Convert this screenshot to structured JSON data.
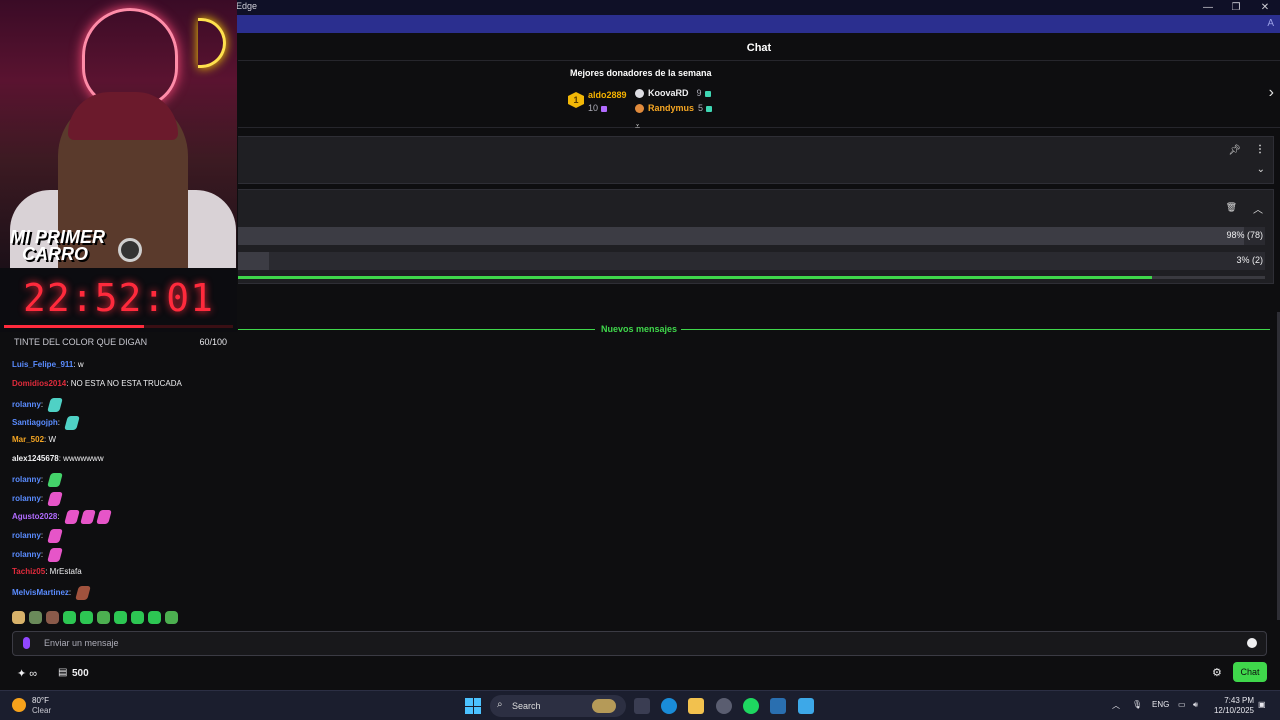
{
  "window": {
    "title": "Edge",
    "controls": [
      "—",
      "❐",
      "✕"
    ]
  },
  "chat": {
    "header": "Chat",
    "donors": {
      "title": "Mejores donadores de la semana",
      "first": {
        "rank": "1",
        "name": "aldo2889",
        "amount": "10"
      },
      "others": [
        {
          "name": "KoovaRD",
          "amount": "9"
        },
        {
          "name": "Randymus",
          "amount": "5"
        }
      ]
    },
    "poll": {
      "options": [
        {
          "percent_label": "98% (78)",
          "percent": 98
        },
        {
          "percent_label": "3% (2)",
          "percent": 3
        }
      ],
      "time_remaining_fraction": 0.89
    },
    "new_messages_label": "Nuevos mensajes",
    "messages": [
      {
        "user": "Luis_Felipe_911",
        "text": "w",
        "color": "#5a8cff"
      },
      {
        "user": "Domidios2014",
        "text": "NO ESTA NO ESTA TRUCADA",
        "color": "#e02b3c"
      },
      {
        "user": "rolanny",
        "text": "",
        "color": "#5a8cff",
        "emote": "#4fd1c5"
      },
      {
        "user": "Santiagojph",
        "text": "",
        "color": "#5a8cff",
        "emote": "#4fd1c5"
      },
      {
        "user": "Mar_502",
        "text": "W",
        "color": "#f5a623"
      },
      {
        "user": "alex1245678",
        "text": "wwwwwww",
        "color": "#efeff1"
      },
      {
        "user": "rolanny",
        "text": "",
        "color": "#5a8cff",
        "emote": "#44d36a"
      },
      {
        "user": "rolanny",
        "text": "",
        "color": "#5a8cff",
        "emote": "#e655c8"
      },
      {
        "user": "Agusto2028",
        "text": "",
        "color": "#b26cff",
        "emote": "#e655c8",
        "emote_count": 3
      },
      {
        "user": "rolanny",
        "text": "",
        "color": "#5a8cff",
        "emote": "#e655c8"
      },
      {
        "user": "rolanny",
        "text": "",
        "color": "#5a8cff",
        "emote": "#e655c8"
      },
      {
        "user": "Tachiz05",
        "text": "MrEstafa",
        "color": "#e02b3c"
      },
      {
        "user": "MelvisMartinez",
        "text": "",
        "color": "#5a8cff",
        "emote": "#a0523d"
      }
    ],
    "input_placeholder": "Enviar un mensaje",
    "points": "500",
    "chat_button": "Chat"
  },
  "overlay": {
    "logo_line1": "MI PRIMER",
    "logo_line2": "CARRO",
    "timer": "22:52:01",
    "timer_progress": 0.61,
    "goal_text": "TINTE DEL COLOR QUE DIGAN",
    "goal_count": "60/100"
  },
  "taskbar": {
    "weather_temp": "80°F",
    "weather_cond": "Clear",
    "search_label": "Search",
    "lang": "ENG",
    "time": "7:43 PM",
    "date": "12/10/2025"
  }
}
